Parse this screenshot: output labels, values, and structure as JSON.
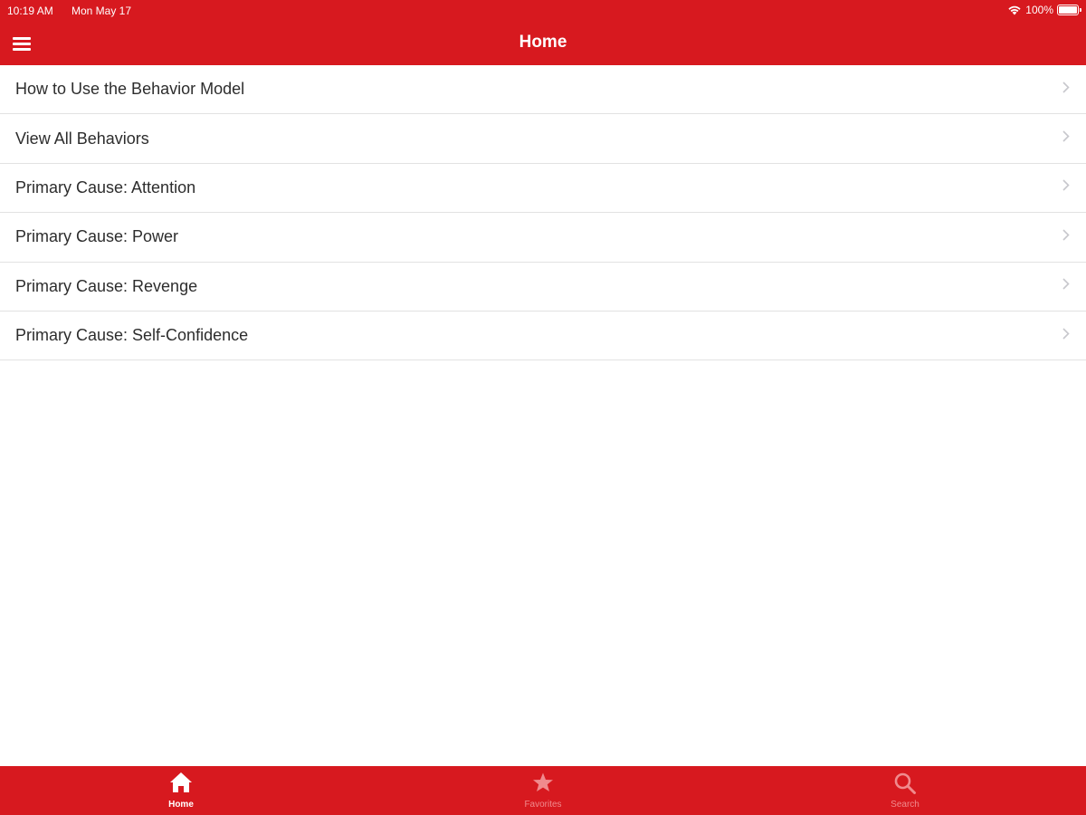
{
  "status_bar": {
    "time": "10:19 AM",
    "date": "Mon May 17",
    "battery": "100%"
  },
  "nav": {
    "title": "Home"
  },
  "list": {
    "items": [
      {
        "label": "How to Use the Behavior Model"
      },
      {
        "label": "View All Behaviors"
      },
      {
        "label": "Primary Cause: Attention"
      },
      {
        "label": "Primary Cause: Power"
      },
      {
        "label": "Primary Cause: Revenge"
      },
      {
        "label": "Primary Cause: Self-Confidence"
      }
    ]
  },
  "tabs": [
    {
      "label": "Home",
      "icon": "home-icon",
      "active": true
    },
    {
      "label": "Favorites",
      "icon": "star-icon",
      "active": false
    },
    {
      "label": "Search",
      "icon": "search-icon",
      "active": false
    }
  ],
  "colors": {
    "brand": "#d7191f",
    "inactive_tab": "#f08a8d"
  }
}
